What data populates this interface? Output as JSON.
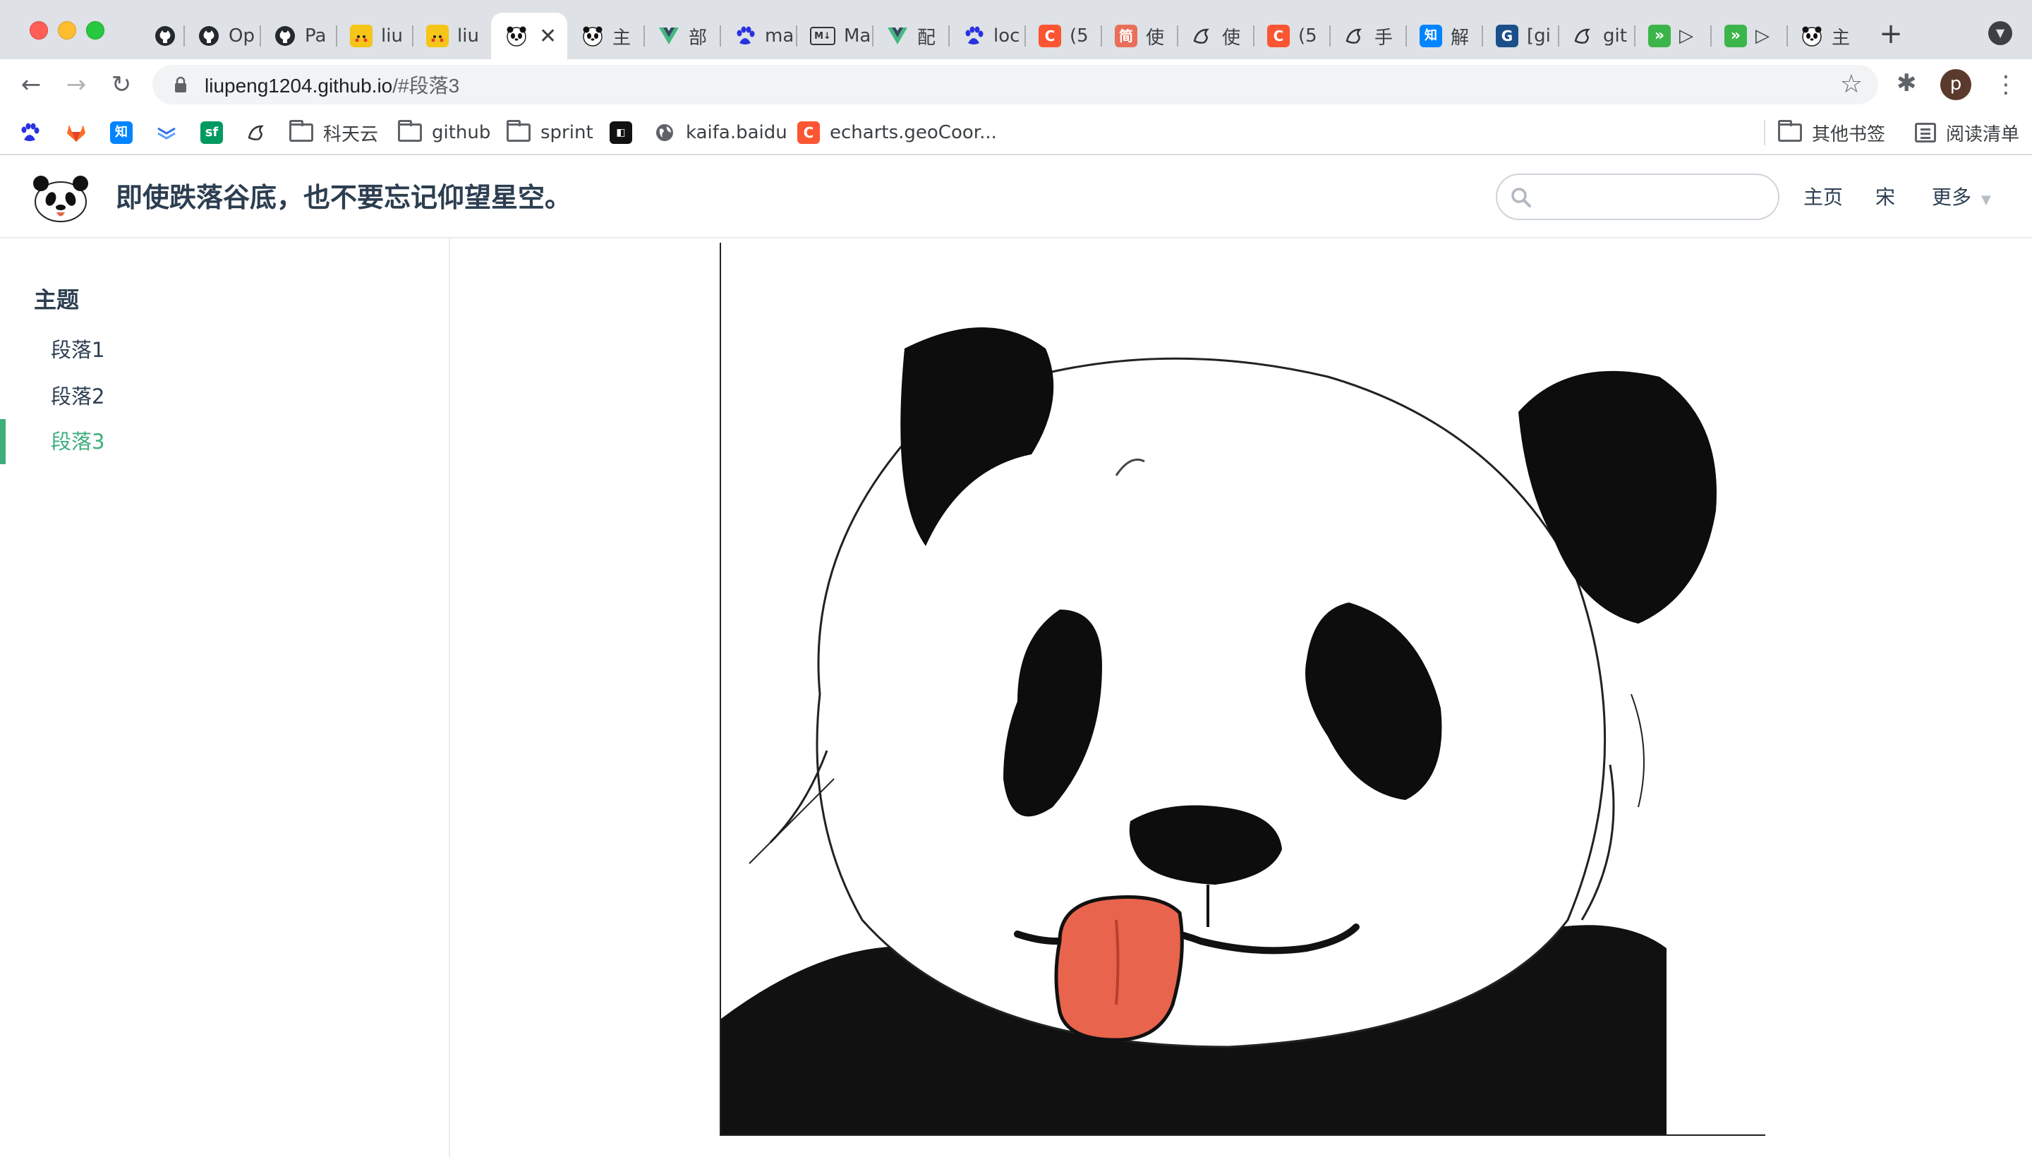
{
  "browser": {
    "tabs": [
      {
        "icon": "github-icon",
        "title": ""
      },
      {
        "icon": "github-icon",
        "title": "Op"
      },
      {
        "icon": "github-icon",
        "title": "Pa"
      },
      {
        "icon": "pikachu-icon",
        "title": "liu"
      },
      {
        "icon": "pikachu-icon",
        "title": "liu"
      },
      {
        "icon": "panda-icon",
        "title": "",
        "active": true
      },
      {
        "icon": "panda-icon",
        "title": "主"
      },
      {
        "icon": "vue-icon",
        "title": "部"
      },
      {
        "icon": "baidu-paw-icon",
        "title": "ma"
      },
      {
        "icon": "markdown-icon",
        "title": "Ma"
      },
      {
        "icon": "vue-icon",
        "title": "配"
      },
      {
        "icon": "baidu-paw-icon",
        "title": "loc"
      },
      {
        "icon": "csdn-icon",
        "title": "(5"
      },
      {
        "icon": "jianshu-icon",
        "title": "使"
      },
      {
        "icon": "yuque-icon",
        "title": "使"
      },
      {
        "icon": "csdn-icon",
        "title": "(5"
      },
      {
        "icon": "yuque-icon",
        "title": "手"
      },
      {
        "icon": "zhihu-icon",
        "title": "解"
      },
      {
        "icon": "g-icon",
        "title": "[gi"
      },
      {
        "icon": "yuque-icon",
        "title": "git"
      },
      {
        "icon": "forward-arrows-icon",
        "title": "▷"
      },
      {
        "icon": "forward-arrows-icon",
        "title": "▷"
      },
      {
        "icon": "panda-icon",
        "title": "主"
      }
    ],
    "address": {
      "host": "liupeng1204.github.io",
      "path": "/#段落3"
    },
    "profile_initial": "p",
    "bookmarks": [
      {
        "icon": "baidu-paw-icon",
        "label": ""
      },
      {
        "icon": "gitlab-icon",
        "label": ""
      },
      {
        "icon": "zhihu-icon",
        "label": ""
      },
      {
        "icon": "lanhu-icon",
        "label": ""
      },
      {
        "icon": "segmentfault-icon",
        "label": ""
      },
      {
        "icon": "yuque-icon",
        "label": ""
      },
      {
        "icon": "folder-icon",
        "label": "科天云"
      },
      {
        "icon": "folder-icon",
        "label": "github"
      },
      {
        "icon": "folder-icon",
        "label": "sprint"
      },
      {
        "icon": "bytedance-icon",
        "label": ""
      },
      {
        "icon": "globe-icon",
        "label": "kaifa.baidu"
      },
      {
        "icon": "csdn-icon",
        "label": "echarts.geoCoor..."
      }
    ],
    "other_bookmarks": "其他书签",
    "reading_list": "阅读清单"
  },
  "site": {
    "title": "即使跌落谷底，也不要忘记仰望星空。",
    "search_placeholder": "",
    "nav": {
      "home": "主页",
      "song": "宋",
      "more": "更多"
    }
  },
  "sidebar": {
    "heading": "主题",
    "items": [
      {
        "label": "段落1"
      },
      {
        "label": "段落2"
      },
      {
        "label": "段落3",
        "active": true
      }
    ]
  },
  "colors": {
    "accent": "#3eaf7c",
    "text": "#2c3e50",
    "chrome_bg": "#dee1e6"
  }
}
